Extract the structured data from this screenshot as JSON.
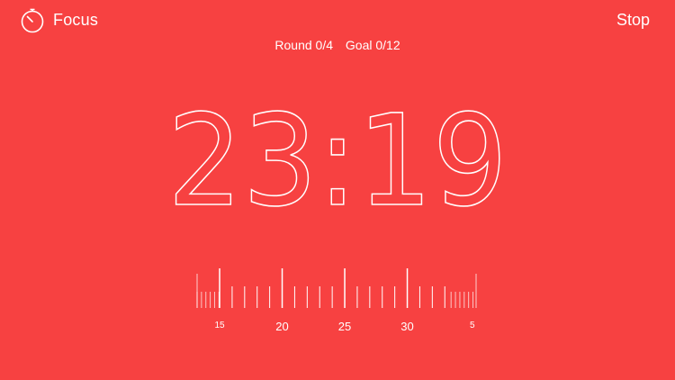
{
  "header": {
    "mode_label": "Focus",
    "stop_label": "Stop",
    "timer_icon": "stopwatch-icon"
  },
  "progress": {
    "round_label": "Round 0/4",
    "goal_label": "Goal 0/12"
  },
  "timer": {
    "display": "23:19"
  },
  "scale": {
    "labels": [
      {
        "text": "15",
        "minute": 15
      },
      {
        "text": "20",
        "minute": 20
      },
      {
        "text": "25",
        "minute": 25
      },
      {
        "text": "30",
        "minute": 30
      },
      {
        "text": "5",
        "minute": 35
      }
    ],
    "current_minute": 25
  },
  "colors": {
    "background": "#f74141",
    "foreground": "#ffffff"
  }
}
